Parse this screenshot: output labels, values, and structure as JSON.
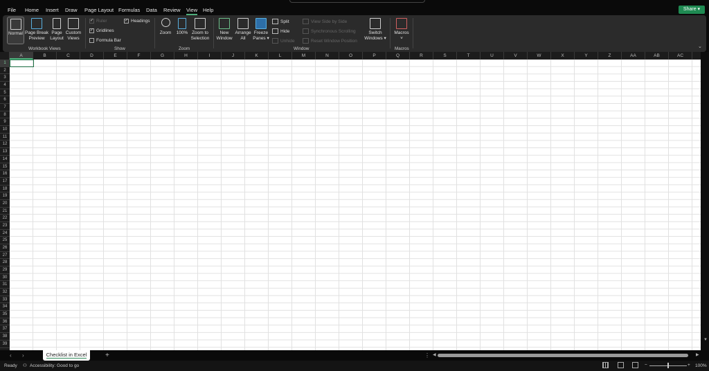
{
  "menu": [
    "File",
    "Home",
    "Insert",
    "Draw",
    "Page Layout",
    "Formulas",
    "Data",
    "Review",
    "View",
    "Help"
  ],
  "active_menu": "View",
  "share_label": "Share ▾",
  "ribbon": {
    "workbook_views": {
      "label": "Workbook Views",
      "normal": "Normal",
      "page_break": "Page Break Preview",
      "page_layout": "Page Layout",
      "custom_views": "Custom Views"
    },
    "show": {
      "label": "Show",
      "ruler": "Ruler",
      "gridlines": "Gridlines",
      "formula_bar": "Formula Bar",
      "headings": "Headings"
    },
    "zoom": {
      "label": "Zoom",
      "zoom": "Zoom",
      "hundred": "100%",
      "zoom_selection": "Zoom to Selection"
    },
    "window": {
      "label": "Window",
      "new_window": "New Window",
      "arrange_all": "Arrange All",
      "freeze_panes": "Freeze Panes ▾",
      "split": "Split",
      "hide": "Hide",
      "unhide": "Unhide",
      "side_by_side": "View Side by Side",
      "sync_scroll": "Synchronous Scrolling",
      "reset_pos": "Reset Window Position",
      "switch_windows": "Switch Windows ▾"
    },
    "macros": {
      "label": "Macros",
      "macros": "Macros",
      "arrow": "˅"
    }
  },
  "columns": [
    "A",
    "B",
    "C",
    "D",
    "E",
    "F",
    "G",
    "H",
    "I",
    "J",
    "K",
    "L",
    "M",
    "N",
    "O",
    "P",
    "Q",
    "R",
    "S",
    "T",
    "U",
    "V",
    "W",
    "X",
    "Y",
    "Z",
    "AA",
    "AB",
    "AC"
  ],
  "rows": [
    "1",
    "2",
    "3",
    "4",
    "5",
    "6",
    "7",
    "8",
    "9",
    "10",
    "11",
    "12",
    "13",
    "14",
    "15",
    "16",
    "17",
    "18",
    "19",
    "20",
    "21",
    "22",
    "23",
    "24",
    "25",
    "26",
    "27",
    "28",
    "29",
    "30",
    "31",
    "32",
    "33",
    "34",
    "35",
    "36",
    "37",
    "38",
    "39"
  ],
  "sheet_tab": "Checklist in Excel",
  "add_sheet": "+",
  "status": {
    "ready": "Ready",
    "accessibility": "Accessibility: Good to go",
    "zoom": "100%"
  }
}
